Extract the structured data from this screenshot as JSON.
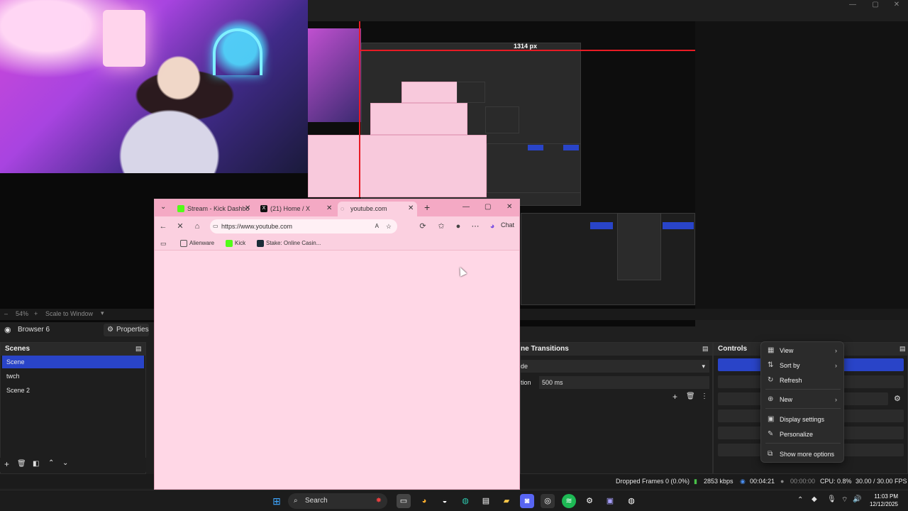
{
  "obs": {
    "preview": {
      "zoom": "54%",
      "scale_mode": "Scale to Window",
      "measure_label": "1314 px"
    },
    "source_bar": {
      "source_name": "Browser 6",
      "properties_label": "Properties"
    },
    "scenes": {
      "title": "Scenes",
      "items": [
        {
          "label": "Scene",
          "active": true
        },
        {
          "label": "twch",
          "active": false
        },
        {
          "label": "Scene 2",
          "active": false
        }
      ]
    },
    "transitions": {
      "title": "ne Transitions",
      "type_value": "de",
      "duration_label": "tion",
      "duration_value": "500 ms"
    },
    "controls": {
      "title": "Controls"
    },
    "status": {
      "dropped_frames": "Dropped Frames 0 (0.0%)",
      "bitrate": "2853 kbps",
      "live_time": "00:04:21",
      "rec_time": "00:00:00",
      "cpu": "CPU: 0.8%",
      "fps": "30.00 / 30.00 FPS"
    }
  },
  "browser": {
    "tabs": [
      {
        "label": "Stream - Kick Dashbo",
        "active": false
      },
      {
        "label": "(21) Home / X",
        "active": false
      },
      {
        "label": "youtube.com",
        "active": true
      }
    ],
    "address": "https://www.youtube.com",
    "chat_label": "Chat",
    "bookmarks": [
      {
        "label": "Alienware",
        "color": "#f0b8ca"
      },
      {
        "label": "Kick",
        "color": "#53fc18"
      },
      {
        "label": "Stake: Online Casin...",
        "color": "#1a2c38"
      }
    ]
  },
  "context_menu": {
    "items": [
      {
        "label": "View",
        "icon": "grid-icon",
        "submenu": true
      },
      {
        "label": "Sort by",
        "icon": "sort-icon",
        "submenu": true
      },
      {
        "label": "Refresh",
        "icon": "refresh-icon",
        "submenu": false
      },
      {
        "label": "New",
        "icon": "plus-circle-icon",
        "submenu": true
      },
      {
        "label": "Display settings",
        "icon": "display-icon",
        "submenu": false
      },
      {
        "label": "Personalize",
        "icon": "brush-icon",
        "submenu": false
      },
      {
        "label": "Show more options",
        "icon": "more-options-icon",
        "submenu": false
      }
    ]
  },
  "taskbar": {
    "search_label": "Search",
    "time": "11:03 PM",
    "date": "12/12/2025"
  },
  "colors": {
    "accent_blue": "#2944c8",
    "browser_pink": "#ffd7e6",
    "tab_pink": "#f4a9c4",
    "red_guide": "#e81b24"
  }
}
